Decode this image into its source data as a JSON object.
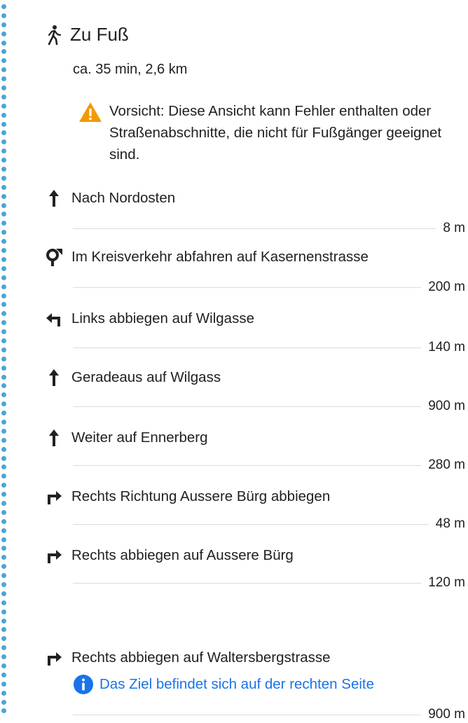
{
  "header": {
    "title": "Zu Fuß",
    "icon": "walking-person-icon"
  },
  "summary": "ca. 35 min, 2,6 km",
  "warning": {
    "icon": "warning-triangle-icon",
    "color": "#f29900",
    "text": "Vorsicht: Diese Ansicht kann Fehler enthalten oder Straßenabschnitte, die nicht für Fußgänger geeignet sind."
  },
  "steps": [
    {
      "icon": "straight-arrow-icon",
      "label": "Nach Nordosten",
      "distance": "8 m"
    },
    {
      "icon": "roundabout-icon",
      "label": "Im Kreisverkehr abfahren auf Kasernenstrasse",
      "distance": "200 m"
    },
    {
      "icon": "turn-left-icon",
      "label": "Links abbiegen auf Wilgasse",
      "distance": "140 m"
    },
    {
      "icon": "straight-arrow-icon",
      "label": "Geradeaus auf Wilgass",
      "distance": "900 m"
    },
    {
      "icon": "straight-arrow-icon",
      "label": "Weiter auf Ennerberg",
      "distance": "280 m"
    },
    {
      "icon": "turn-right-icon",
      "label": "Rechts Richtung Aussere Bürg abbiegen",
      "distance": "48 m"
    },
    {
      "icon": "turn-right-icon",
      "label": "Rechts abbiegen auf Aussere Bürg",
      "distance": "120 m"
    },
    {
      "icon": "turn-right-icon",
      "label": "Rechts abbiegen auf Waltersbergstrasse",
      "distance": "900 m"
    }
  ],
  "destination_note": {
    "icon": "info-icon",
    "color": "#1a73e8",
    "text": "Das Ziel befindet sich auf der rechten Seite"
  },
  "route_line_color": "#4aa6d6"
}
